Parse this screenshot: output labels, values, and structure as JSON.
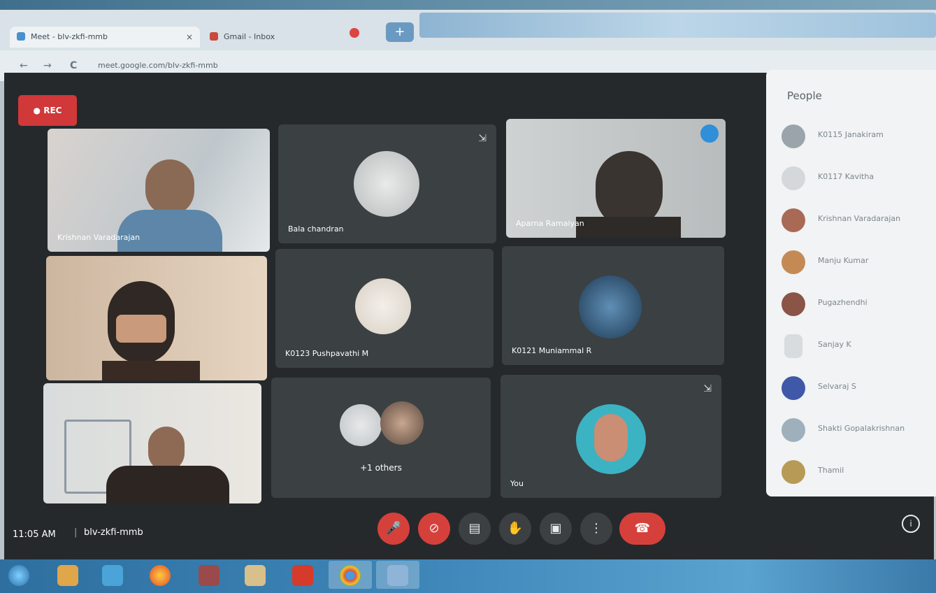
{
  "browser": {
    "tabs": [
      {
        "label": "Meet - blv-zkfi-mmb"
      },
      {
        "label": "Gmail - Inbox"
      }
    ],
    "new_tab": "+",
    "close": "×",
    "url": "meet.google.com/blv-zkfi-mmb",
    "nav": {
      "back": "←",
      "forward": "→",
      "reload": "C"
    }
  },
  "meet": {
    "rec_label": "REC",
    "clock": "11:05 AM",
    "meeting_code": "blv-zkfi-mmb",
    "tiles": [
      {
        "name": "Krishnan Varadarajan"
      },
      {
        "name": "Bala chandran"
      },
      {
        "name": "Aparna Ramaiyan"
      },
      {
        "name": ""
      },
      {
        "name": "K0123 Pushpavathi M"
      },
      {
        "name": "K0121 Muniammal R"
      },
      {
        "name": ""
      },
      {
        "name": "+1 others"
      },
      {
        "name": "You"
      }
    ],
    "controls": {
      "mic": "🎤",
      "camera": "⊘",
      "captions": "▤",
      "hand": "✋",
      "present": "▣",
      "more": "⋮",
      "hangup": "☎",
      "info": "i"
    }
  },
  "people_panel": {
    "title": "People",
    "people": [
      {
        "name": "K0115 Janakiram"
      },
      {
        "name": "K0117 Kavitha"
      },
      {
        "name": "Krishnan Varadarajan"
      },
      {
        "name": "Manju Kumar"
      },
      {
        "name": "Pugazhendhi"
      },
      {
        "name": "Sanjay K"
      },
      {
        "name": "Selvaraj S"
      },
      {
        "name": "Shakti Gopalakrishnan"
      },
      {
        "name": "Thamil"
      }
    ]
  }
}
